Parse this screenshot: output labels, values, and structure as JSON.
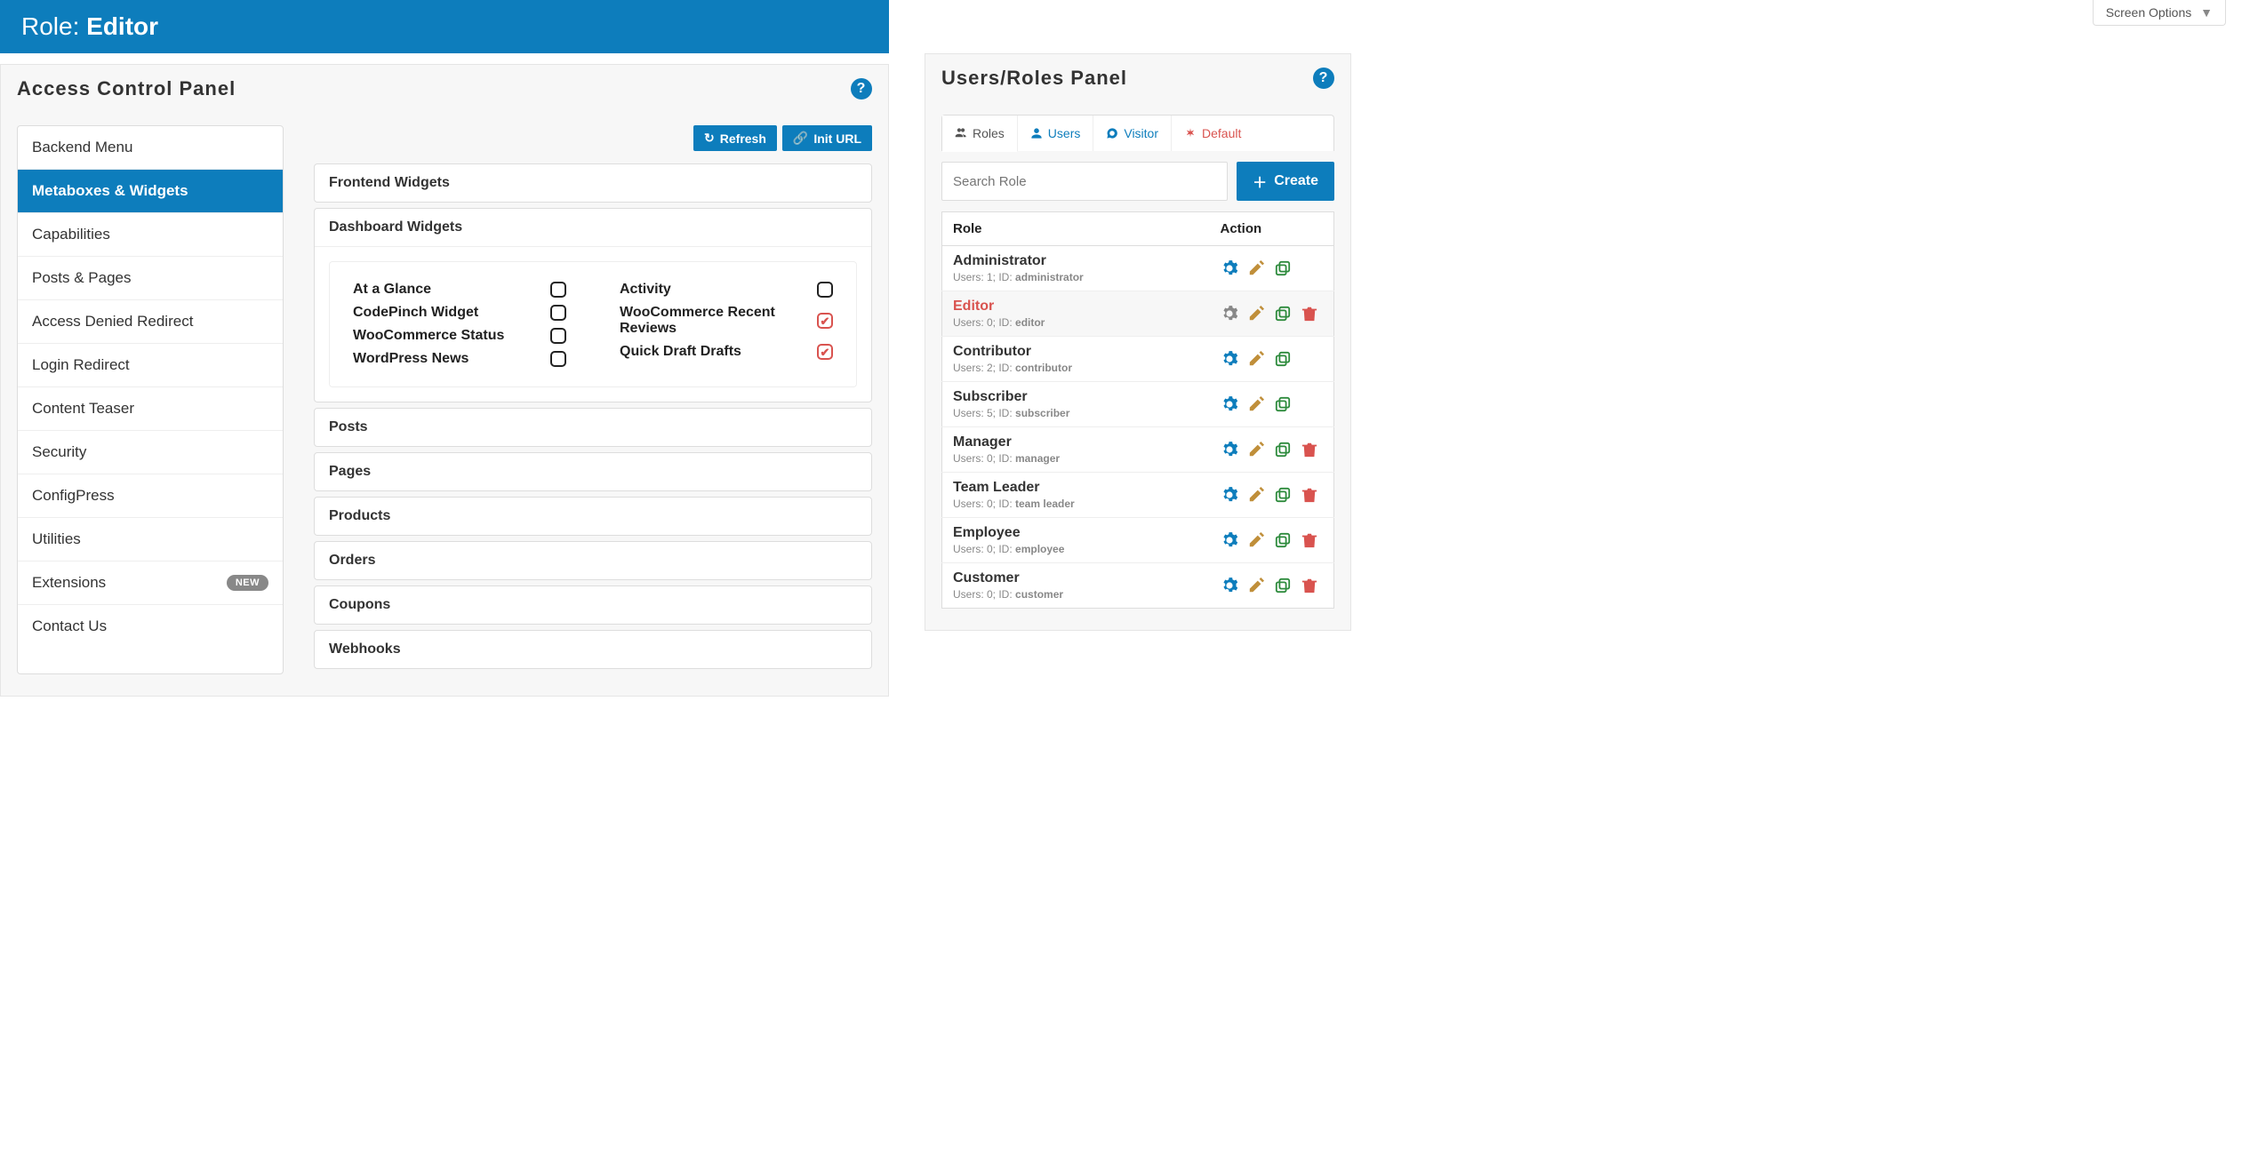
{
  "screenOptions": "Screen Options",
  "roleBar": {
    "prefix": "Role:",
    "name": "Editor"
  },
  "acp": {
    "title": "Access Control Panel",
    "nav": [
      {
        "label": "Backend Menu",
        "active": false
      },
      {
        "label": "Metaboxes & Widgets",
        "active": true
      },
      {
        "label": "Capabilities",
        "active": false
      },
      {
        "label": "Posts & Pages",
        "active": false
      },
      {
        "label": "Access Denied Redirect",
        "active": false
      },
      {
        "label": "Login Redirect",
        "active": false
      },
      {
        "label": "Content Teaser",
        "active": false
      },
      {
        "label": "Security",
        "active": false
      },
      {
        "label": "ConfigPress",
        "active": false
      },
      {
        "label": "Utilities",
        "active": false
      },
      {
        "label": "Extensions",
        "active": false,
        "badge": "NEW"
      },
      {
        "label": "Contact Us",
        "active": false
      }
    ],
    "buttons": {
      "refresh": "Refresh",
      "initUrl": "Init URL"
    },
    "sections": [
      {
        "title": "Frontend Widgets",
        "open": false
      },
      {
        "title": "Dashboard Widgets",
        "open": true,
        "cols": [
          [
            {
              "label": "At a Glance",
              "checked": false
            },
            {
              "label": "CodePinch Widget",
              "checked": false
            },
            {
              "label": "WooCommerce Status",
              "checked": false
            },
            {
              "label": "WordPress News",
              "checked": false
            }
          ],
          [
            {
              "label": "Activity",
              "checked": false
            },
            {
              "label": "WooCommerce Recent Reviews",
              "checked": true
            },
            {
              "label": "Quick Draft Drafts",
              "checked": true
            }
          ]
        ]
      },
      {
        "title": "Posts",
        "open": false
      },
      {
        "title": "Pages",
        "open": false
      },
      {
        "title": "Products",
        "open": false
      },
      {
        "title": "Orders",
        "open": false
      },
      {
        "title": "Coupons",
        "open": false
      },
      {
        "title": "Webhooks",
        "open": false
      }
    ]
  },
  "usersPanel": {
    "title": "Users/Roles Panel",
    "tabs": [
      {
        "label": "Roles",
        "icon": "group",
        "active": true
      },
      {
        "label": "Users",
        "icon": "user"
      },
      {
        "label": "Visitor",
        "icon": "visitor"
      },
      {
        "label": "Default",
        "icon": "asterisk",
        "danger": true
      }
    ],
    "searchPlaceholder": "Search Role",
    "createLabel": "Create",
    "tableHead": {
      "role": "Role",
      "action": "Action"
    },
    "metaLabels": {
      "usersPrefix": "Users:",
      "idPrefix": "ID:"
    },
    "roles": [
      {
        "name": "Administrator",
        "users": 1,
        "id": "administrator",
        "selected": false,
        "actions": [
          "gear",
          "pencil",
          "clone"
        ]
      },
      {
        "name": "Editor",
        "users": 0,
        "id": "editor",
        "selected": true,
        "actions": [
          "gear-gray",
          "pencil",
          "clone",
          "trash"
        ]
      },
      {
        "name": "Contributor",
        "users": 2,
        "id": "contributor",
        "selected": false,
        "actions": [
          "gear",
          "pencil",
          "clone"
        ]
      },
      {
        "name": "Subscriber",
        "users": 5,
        "id": "subscriber",
        "selected": false,
        "actions": [
          "gear",
          "pencil",
          "clone"
        ]
      },
      {
        "name": "Manager",
        "users": 0,
        "id": "manager",
        "selected": false,
        "actions": [
          "gear",
          "pencil",
          "clone",
          "trash"
        ]
      },
      {
        "name": "Team Leader",
        "users": 0,
        "id": "team leader",
        "selected": false,
        "actions": [
          "gear",
          "pencil",
          "clone",
          "trash"
        ]
      },
      {
        "name": "Employee",
        "users": 0,
        "id": "employee",
        "selected": false,
        "actions": [
          "gear",
          "pencil",
          "clone",
          "trash"
        ]
      },
      {
        "name": "Customer",
        "users": 0,
        "id": "customer",
        "selected": false,
        "actions": [
          "gear",
          "pencil",
          "clone",
          "trash"
        ]
      }
    ]
  }
}
